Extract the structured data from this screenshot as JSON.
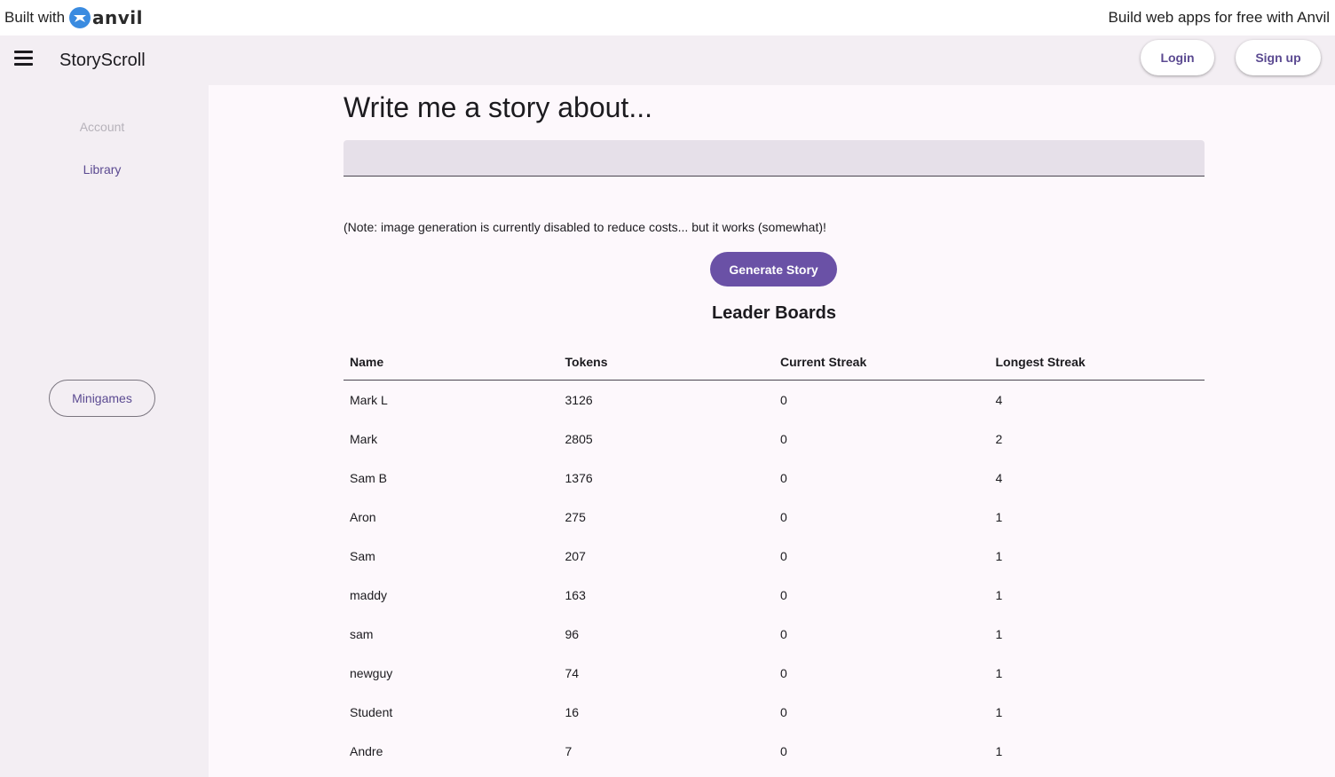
{
  "banner": {
    "built_with": "Built with",
    "logo_word": "anvil",
    "promo": "Build web apps for free with Anvil"
  },
  "header": {
    "menu_icon": "hamburger-icon",
    "title": "StoryScroll",
    "login": "Login",
    "signup": "Sign up"
  },
  "sidebar": {
    "account": "Account",
    "library": "Library",
    "minigames": "Minigames"
  },
  "main": {
    "heading": "Write me a story about...",
    "input_value": "",
    "note": "(Note: image generation is currently disabled to reduce costs... but it works (somewhat)!",
    "generate": "Generate Story",
    "leaderboard_title": "Leader Boards",
    "columns": [
      "Name",
      "Tokens",
      "Current Streak",
      "Longest Streak"
    ],
    "rows": [
      [
        "Mark L",
        "3126",
        "0",
        "4"
      ],
      [
        "Mark",
        "2805",
        "0",
        "2"
      ],
      [
        "Sam B",
        "1376",
        "0",
        "4"
      ],
      [
        "Aron",
        "275",
        "0",
        "1"
      ],
      [
        "Sam",
        "207",
        "0",
        "1"
      ],
      [
        "maddy",
        "163",
        "0",
        "1"
      ],
      [
        "sam",
        "96",
        "0",
        "1"
      ],
      [
        "newguy",
        "74",
        "0",
        "1"
      ],
      [
        "Student",
        "16",
        "0",
        "1"
      ],
      [
        "Andre",
        "7",
        "0",
        "1"
      ]
    ]
  },
  "colors": {
    "accent": "#6a51a6",
    "link": "#5b4a91",
    "surface": "#f3eef3",
    "background": "#fdf8fc",
    "anvil_blue": "#3a8be0"
  }
}
